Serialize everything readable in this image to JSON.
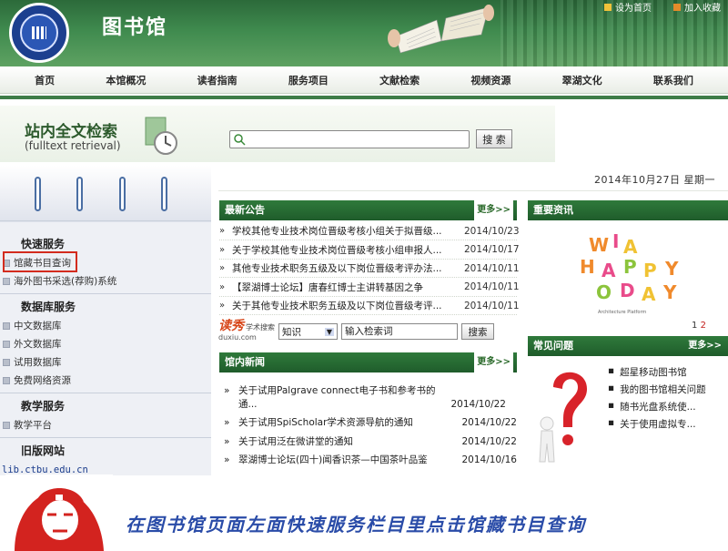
{
  "header": {
    "library_title": "图书馆",
    "top_links": [
      "设为首页",
      "加入收藏"
    ]
  },
  "nav": [
    "首页",
    "本馆概况",
    "读者指南",
    "服务项目",
    "文献检索",
    "视频资源",
    "翠湖文化",
    "联系我们"
  ],
  "fulltext": {
    "title": "站内全文检索",
    "subtitle": "(fulltext retrieval)",
    "search_button": "搜 索",
    "input_value": ""
  },
  "sidebar": {
    "quick_services_title": "快速服务",
    "quick_services": [
      "馆藏书目查询",
      "海外图书采选(荐购)系统"
    ],
    "db_title": "数据库服务",
    "db_items": [
      "中文数据库",
      "外文数据库",
      "试用数据库",
      "免费网络资源"
    ],
    "teaching_title": "教学服务",
    "teaching_items": [
      "教学平台"
    ],
    "old_site_title": "旧版网站",
    "old_site_url": "lib.ctbu.edu.cn"
  },
  "date": "2014年10月27日   星期一",
  "announcements": {
    "title": "最新公告",
    "more": "更多>>",
    "items": [
      {
        "title": "学校其他专业技术岗位晋级考核小组关于拟晋级...",
        "date": "2014/10/23"
      },
      {
        "title": "关于学校其他专业技术岗位晋级考核小组申报人...",
        "date": "2014/10/17"
      },
      {
        "title": "其他专业技术职务五级及以下岗位晋级考评办法...",
        "date": "2014/10/11"
      },
      {
        "title": "【翠湖博士论坛】唐春红博士主讲转基因之争",
        "date": "2014/10/11"
      },
      {
        "title": "关于其他专业技术职务五级及以下岗位晋级考评...",
        "date": "2014/10/11"
      }
    ]
  },
  "duxiu": {
    "logo": "读秀",
    "logo_sub": "学术搜索",
    "domain": "duxiu.com",
    "select_value": "知识",
    "input_value": "输入检索词",
    "button": "搜索"
  },
  "news": {
    "title": "馆内新闻",
    "more": "更多>>",
    "items": [
      {
        "title": "关于试用Palgrave connect电子书和参考书的通...",
        "date": "2014/10/22"
      },
      {
        "title": "关于试用SpiScholar学术资源导航的通知",
        "date": "2014/10/22"
      },
      {
        "title": "关于试用泛在微讲堂的通知",
        "date": "2014/10/22"
      },
      {
        "title": "翠湖博士论坛(四十)闻香识茶—中国茶叶品鉴",
        "date": "2014/10/16"
      }
    ]
  },
  "important": {
    "title": "重要资讯",
    "image_caption": "Architecture Platform",
    "pages": [
      "1",
      "2"
    ]
  },
  "faq": {
    "title": "常见问题",
    "more": "更多>>",
    "items": [
      "超星移动图书馆",
      "我的图书馆相关问题",
      "随书光盘系统使...",
      "关于使用虚拟专..."
    ]
  },
  "banner": {
    "instruction": "在图书馆页面左面快速服务栏目里点击馆藏书目查询"
  },
  "colors": {
    "header_green": "#3f8a4e",
    "panel_green": "#1f5c2b",
    "highlight_red": "#d32b1e",
    "instruction_blue": "#2a4ca8"
  }
}
